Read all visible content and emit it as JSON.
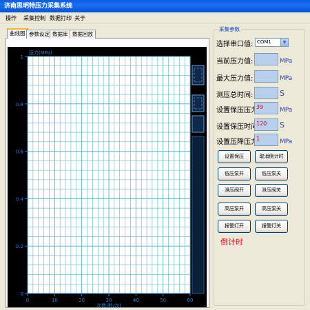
{
  "app": {
    "title": "济南思明特压力采集系统"
  },
  "menu": [
    {
      "label": "操作"
    },
    {
      "label": "采集控制"
    },
    {
      "label": "数据打印"
    },
    {
      "label": "关于"
    }
  ],
  "tabs": [
    {
      "label": "曲线图",
      "active": true
    },
    {
      "label": "参数设定"
    },
    {
      "label": "数据库"
    },
    {
      "label": "数据回放"
    }
  ],
  "params": {
    "group_title": "采集参数",
    "port_label": "选择串口值:",
    "port_value": "COM1",
    "current_label": "当前压力值:",
    "current_value": "",
    "current_unit": "MPa",
    "max_label": "最大压力值:",
    "max_value": "",
    "max_unit": "MPa",
    "total_time_label": "测压总时间:",
    "total_time_value": "",
    "total_time_unit": "S",
    "hold_pressure_label": "设置保压压力",
    "hold_pressure_value": "39",
    "hold_pressure_unit": "MPa",
    "hold_time_label": "设置保压时间",
    "hold_time_value": "120",
    "hold_time_unit": "S",
    "drop_pressure_label": "设置压降压力",
    "drop_pressure_value": "1",
    "drop_pressure_unit": "MPa",
    "countdown_label": "倒计时"
  },
  "buttons": {
    "set_hold": "设置保压",
    "cancel_countdown": "取消倒计时",
    "low_pump_on": "低压泵开",
    "low_pump_off": "低压泵关",
    "release_valve_on": "泄压阀开",
    "release_valve_off": "泄压阀关",
    "high_pump_on": "高压泵开",
    "high_pump_off": "高压泵关",
    "alarm_light_on": "报警灯开",
    "alarm_light_off": "报警灯关"
  },
  "chart_data": {
    "type": "line",
    "ylabel": "压力(MPa)",
    "xlabel": "次数(秒/次)",
    "xlim": [
      0,
      60
    ],
    "ylim": [
      0,
      1
    ],
    "x_ticks": [
      0,
      10,
      20,
      30,
      40,
      50,
      60
    ],
    "y_ticks": [
      0,
      0.2,
      0.4,
      0.6,
      0.8,
      1
    ],
    "y_tick_labels": [
      "0",
      "0.2",
      "0.4",
      "0.6",
      "0.8",
      "1"
    ],
    "grid": true,
    "series": [],
    "colors": {
      "background": "#000000",
      "plot": "#ffffff",
      "grid": "#5ab8c8",
      "text": "#2f7fe0"
    }
  }
}
